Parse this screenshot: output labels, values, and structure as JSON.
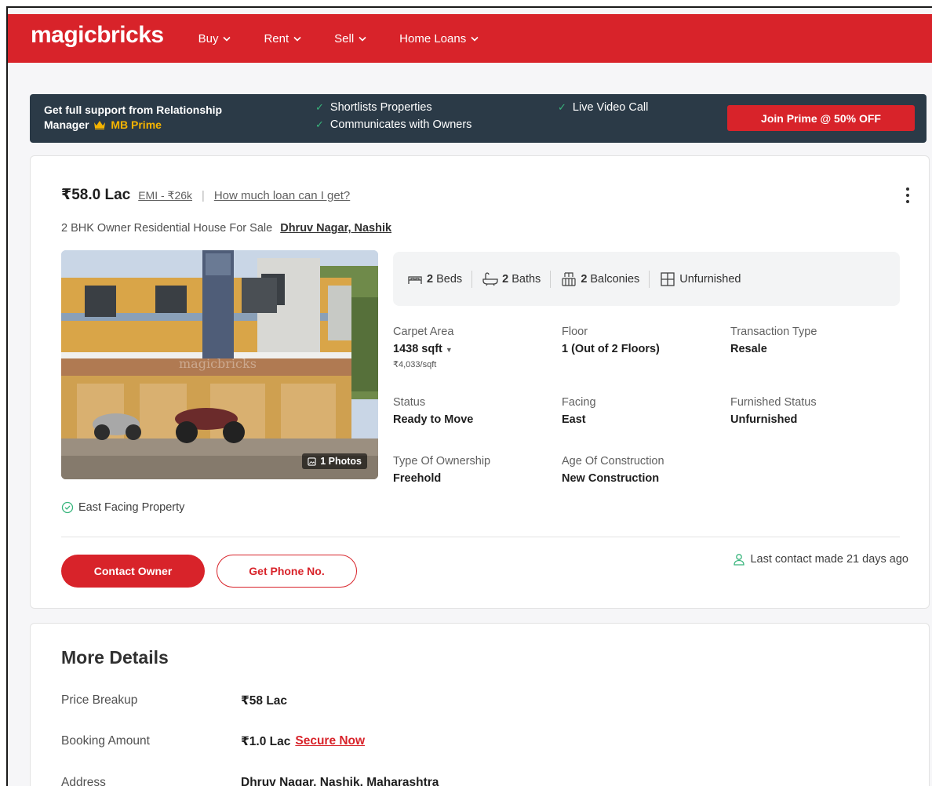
{
  "nav": {
    "logo": "magicbricks",
    "items": [
      {
        "label": "Buy"
      },
      {
        "label": "Rent"
      },
      {
        "label": "Sell"
      },
      {
        "label": "Home Loans"
      }
    ]
  },
  "prime": {
    "line1": "Get full support from Relationship",
    "line2_prefix": "Manager",
    "brand": "MB Prime",
    "features": [
      "Shortlists Properties",
      "Communicates with Owners",
      "Live Video Call"
    ],
    "cta": "Join Prime @ 50% OFF"
  },
  "listing": {
    "price": "₹58.0 Lac",
    "emi": "EMI - ₹26k",
    "separator": "|",
    "loan_link": "How much loan can I get?",
    "title": "2 BHK Owner Residential House For Sale",
    "locality": "Dhruv Nagar, Nashik",
    "photo_count": "1 Photos",
    "photo_watermark": "magicbricks",
    "amenities": [
      {
        "num": "2",
        "label": "Beds",
        "icon": "bed-icon"
      },
      {
        "num": "2",
        "label": "Baths",
        "icon": "bath-icon"
      },
      {
        "num": "2",
        "label": "Balconies",
        "icon": "balcony-icon"
      },
      {
        "num": "",
        "label": "Unfurnished",
        "icon": "window-icon"
      }
    ],
    "details": {
      "carpet_area": {
        "label": "Carpet Area",
        "value": "1438 sqft",
        "sub": "₹4,033/sqft"
      },
      "floor": {
        "label": "Floor",
        "value": "1 (Out of 2 Floors)"
      },
      "transaction": {
        "label": "Transaction Type",
        "value": "Resale"
      },
      "status": {
        "label": "Status",
        "value": "Ready to Move"
      },
      "facing": {
        "label": "Facing",
        "value": "East"
      },
      "furnished": {
        "label": "Furnished Status",
        "value": "Unfurnished"
      },
      "ownership": {
        "label": "Type Of Ownership",
        "value": "Freehold"
      },
      "age": {
        "label": "Age Of Construction",
        "value": "New Construction"
      }
    },
    "highlight": "East Facing Property",
    "contact_btn": "Contact Owner",
    "phone_btn": "Get Phone No.",
    "last_contact": "Last contact made 21 days ago"
  },
  "more_details": {
    "title": "More Details",
    "rows": [
      {
        "key": "Price Breakup",
        "value": "₹58 Lac"
      },
      {
        "key": "Booking Amount",
        "value": "₹1.0 Lac",
        "link": "Secure Now"
      },
      {
        "key": "Address",
        "value": "Dhruv Nagar, Nashik, Maharashtra"
      }
    ]
  },
  "colors": {
    "brand_red": "#d8232a",
    "prime_bg": "#2b3a47",
    "check_green": "#38b57c",
    "gold": "#f5b400"
  }
}
